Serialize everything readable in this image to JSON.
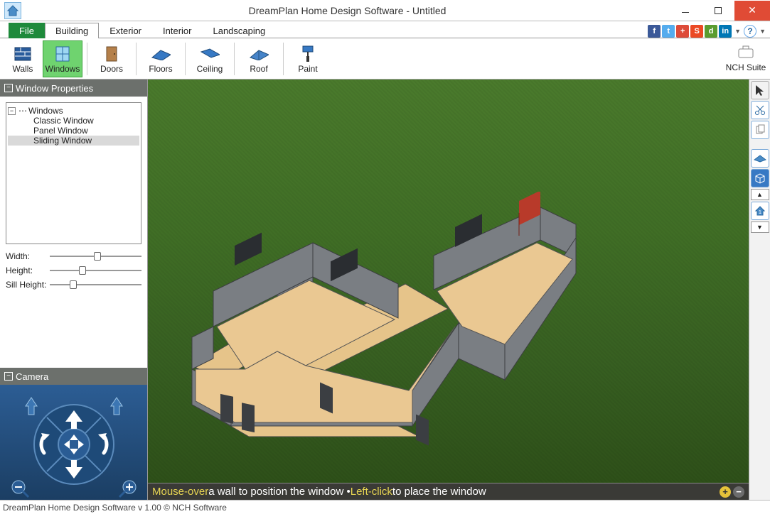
{
  "titlebar": {
    "title": "DreamPlan Home Design Software - Untitled"
  },
  "tabs": {
    "file": "File",
    "items": [
      "Building",
      "Exterior",
      "Interior",
      "Landscaping"
    ],
    "active_index": 0
  },
  "social": {
    "facebook": "f",
    "twitter": "t",
    "google": "+",
    "stumble": "S",
    "digg": "d",
    "linkedin": "in"
  },
  "ribbon": {
    "items": [
      {
        "label": "Walls"
      },
      {
        "label": "Windows",
        "active": true
      },
      {
        "label": "Doors"
      },
      {
        "label": "Floors"
      },
      {
        "label": "Ceiling"
      },
      {
        "label": "Roof"
      },
      {
        "label": "Paint"
      }
    ],
    "suite_label": "NCH Suite"
  },
  "properties": {
    "title": "Window Properties",
    "tree_root": "Windows",
    "tree_items": [
      "Classic Window",
      "Panel Window",
      "Sliding Window"
    ],
    "selected_index": 2,
    "sliders": {
      "width": {
        "label": "Width:",
        "position": 0.48
      },
      "height": {
        "label": "Height:",
        "position": 0.32
      },
      "sill": {
        "label": "Sill Height:",
        "position": 0.22
      }
    }
  },
  "camera": {
    "title": "Camera"
  },
  "hint": {
    "a": "Mouse-over",
    "b": " a wall to position the window • ",
    "c": "Left-click",
    "d": " to place the window"
  },
  "statusbar": {
    "text": "DreamPlan Home Design Software v 1.00 © NCH Software"
  }
}
